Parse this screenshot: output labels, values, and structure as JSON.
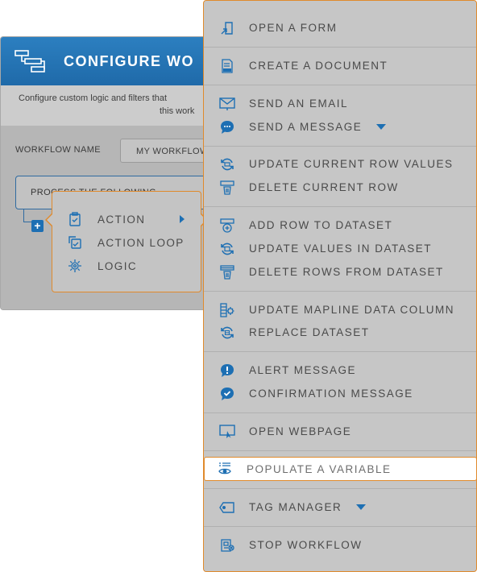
{
  "dialog": {
    "title": "CONFIGURE WO",
    "description_line1": "Configure custom logic and filters that",
    "description_line2": "this work",
    "workflow_name_label": "WORKFLOW NAME",
    "workflow_name_value": "MY WORKFLOW",
    "process_text": "PROCESS THE FOLLOWING",
    "add_symbol": "+"
  },
  "submenu": {
    "items": [
      {
        "label": "ACTION",
        "icon": "clipboard-check-icon",
        "has_submenu": true
      },
      {
        "label": "ACTION LOOP",
        "icon": "action-loop-icon"
      },
      {
        "label": "LOGIC",
        "icon": "logic-icon"
      }
    ]
  },
  "menu": {
    "items": [
      {
        "label": "OPEN A FORM",
        "icon": "open-form-icon"
      },
      {
        "label": "CREATE A DOCUMENT",
        "icon": "pdf-document-icon"
      },
      {
        "label": "SEND AN EMAIL",
        "icon": "email-icon"
      },
      {
        "label": "SEND A MESSAGE",
        "icon": "chat-message-icon",
        "has_dropdown": true
      },
      {
        "label": "UPDATE CURRENT ROW VALUES",
        "icon": "refresh-row-icon"
      },
      {
        "label": "DELETE CURRENT ROW",
        "icon": "delete-row-icon"
      },
      {
        "label": "ADD ROW TO DATASET",
        "icon": "add-row-icon"
      },
      {
        "label": "UPDATE VALUES IN DATASET",
        "icon": "refresh-dataset-icon"
      },
      {
        "label": "DELETE ROWS FROM DATASET",
        "icon": "delete-rows-icon"
      },
      {
        "label": "UPDATE MAPLINE DATA COLUMN",
        "icon": "data-column-gear-icon"
      },
      {
        "label": "REPLACE DATASET",
        "icon": "replace-dataset-icon"
      },
      {
        "label": "ALERT MESSAGE",
        "icon": "alert-bubble-icon"
      },
      {
        "label": "CONFIRMATION MESSAGE",
        "icon": "confirmation-bubble-icon"
      },
      {
        "label": "OPEN WEBPAGE",
        "icon": "webpage-icon"
      },
      {
        "label": "POPULATE A VARIABLE",
        "icon": "variable-eye-icon",
        "highlighted": true
      },
      {
        "label": "TAG MANAGER",
        "icon": "tag-icon",
        "has_dropdown": true
      },
      {
        "label": "STOP WORKFLOW",
        "icon": "stop-workflow-icon"
      }
    ]
  },
  "colors": {
    "accent_blue": "#1d6fb3",
    "highlight_orange": "#e08a2c",
    "menu_text": "#4a4a4a"
  }
}
